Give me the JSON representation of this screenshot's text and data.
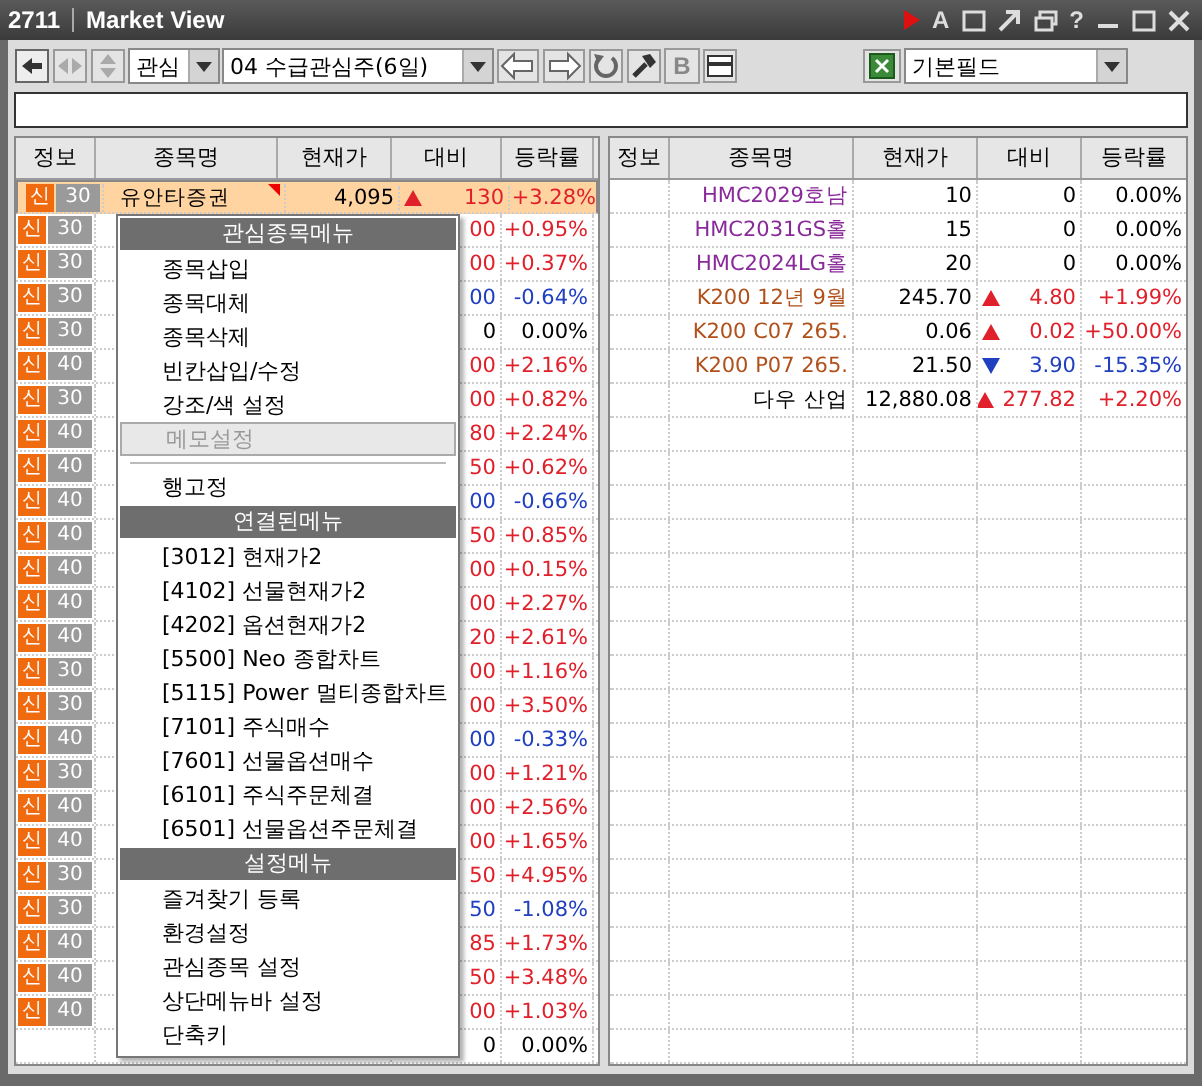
{
  "window": {
    "code": "2711",
    "title": "Market View",
    "help_glyph": "?",
    "font_glyph": "A"
  },
  "toolbar": {
    "group_select": "관심",
    "list_select": "04 수급관심주(6일)",
    "bold_glyph": "B",
    "field_select": "기본필드"
  },
  "left_table": {
    "columns": [
      "정보",
      "종목명",
      "현재가",
      "대비",
      "등락률"
    ],
    "rows": [
      {
        "badge": "신",
        "tag": "30",
        "name": "유안타증권",
        "price": "4,095",
        "arrow_up": true,
        "change": "130",
        "rate": "+3.28%",
        "color": "#e0202a",
        "selected": true,
        "flagged": true
      },
      {
        "badge": "신",
        "tag": "30",
        "change": "00",
        "rate": "+0.95%",
        "color": "#e0202a",
        "selected": false
      },
      {
        "badge": "신",
        "tag": "30",
        "change": "00",
        "rate": "+0.37%",
        "color": "#e0202a",
        "selected": false
      },
      {
        "badge": "신",
        "tag": "30",
        "change": "00",
        "rate": "-0.64%",
        "color": "#2040c0",
        "selected": false
      },
      {
        "badge": "신",
        "tag": "30",
        "change": "0",
        "rate": "0.00%",
        "color": "#000000",
        "selected": false
      },
      {
        "badge": "신",
        "tag": "40",
        "change": "00",
        "rate": "+2.16%",
        "color": "#e0202a",
        "selected": false
      },
      {
        "badge": "신",
        "tag": "30",
        "change": "00",
        "rate": "+0.82%",
        "color": "#e0202a",
        "selected": false
      },
      {
        "badge": "신",
        "tag": "40",
        "change": "80",
        "rate": "+2.24%",
        "color": "#e0202a",
        "selected": false
      },
      {
        "badge": "신",
        "tag": "40",
        "change": "50",
        "rate": "+0.62%",
        "color": "#e0202a",
        "selected": false
      },
      {
        "badge": "신",
        "tag": "40",
        "change": "00",
        "rate": "-0.66%",
        "color": "#2040c0",
        "selected": false
      },
      {
        "badge": "신",
        "tag": "40",
        "change": "50",
        "rate": "+0.85%",
        "color": "#e0202a",
        "selected": false
      },
      {
        "badge": "신",
        "tag": "40",
        "change": "00",
        "rate": "+0.15%",
        "color": "#e0202a",
        "selected": false
      },
      {
        "badge": "신",
        "tag": "40",
        "change": "00",
        "rate": "+2.27%",
        "color": "#e0202a",
        "selected": false
      },
      {
        "badge": "신",
        "tag": "40",
        "change": "20",
        "rate": "+2.61%",
        "color": "#e0202a",
        "selected": false
      },
      {
        "badge": "신",
        "tag": "30",
        "change": "00",
        "rate": "+1.16%",
        "color": "#e0202a",
        "selected": false
      },
      {
        "badge": "신",
        "tag": "30",
        "change": "00",
        "rate": "+3.50%",
        "color": "#e0202a",
        "selected": false
      },
      {
        "badge": "신",
        "tag": "40",
        "change": "00",
        "rate": "-0.33%",
        "color": "#2040c0",
        "selected": false
      },
      {
        "badge": "신",
        "tag": "30",
        "change": "00",
        "rate": "+1.21%",
        "color": "#e0202a",
        "selected": false
      },
      {
        "badge": "신",
        "tag": "40",
        "change": "00",
        "rate": "+2.56%",
        "color": "#e0202a",
        "selected": false
      },
      {
        "badge": "신",
        "tag": "40",
        "change": "00",
        "rate": "+1.65%",
        "color": "#e0202a",
        "selected": false
      },
      {
        "badge": "신",
        "tag": "30",
        "change": "50",
        "rate": "+4.95%",
        "color": "#e0202a",
        "selected": false
      },
      {
        "badge": "신",
        "tag": "30",
        "change": "50",
        "rate": "-1.08%",
        "color": "#2040c0",
        "selected": false
      },
      {
        "badge": "신",
        "tag": "40",
        "change": "85",
        "rate": "+1.73%",
        "color": "#e0202a",
        "selected": false
      },
      {
        "badge": "신",
        "tag": "40",
        "change": "50",
        "rate": "+3.48%",
        "color": "#e0202a",
        "selected": false
      },
      {
        "badge": "신",
        "tag": "40",
        "change": "00",
        "rate": "+1.03%",
        "color": "#e0202a",
        "selected": false
      },
      {
        "change": "0",
        "rate": "0.00%",
        "color": "#000000",
        "selected": false
      }
    ]
  },
  "context_menu": {
    "items": [
      {
        "kind": "header",
        "label": "관심종목메뉴"
      },
      {
        "kind": "item",
        "label": "종목삽입",
        "disabled": false
      },
      {
        "kind": "item",
        "label": "종목대체",
        "disabled": false
      },
      {
        "kind": "item",
        "label": "종목삭제",
        "disabled": false
      },
      {
        "kind": "item",
        "label": "빈칸삽입/수정",
        "disabled": false
      },
      {
        "kind": "item",
        "label": "강조/색 설정",
        "disabled": false
      },
      {
        "kind": "item",
        "label": "메모설정",
        "disabled": true,
        "selected": true
      },
      {
        "kind": "separator"
      },
      {
        "kind": "item",
        "label": "행고정",
        "disabled": false
      },
      {
        "kind": "header",
        "label": "연결된메뉴"
      },
      {
        "kind": "item",
        "label": "[3012] 현재가2",
        "disabled": false
      },
      {
        "kind": "item",
        "label": "[4102] 선물현재가2",
        "disabled": false
      },
      {
        "kind": "item",
        "label": "[4202] 옵션현재가2",
        "disabled": false
      },
      {
        "kind": "item",
        "label": "[5500] Neo 종합차트",
        "disabled": false
      },
      {
        "kind": "item",
        "label": "[5115] Power 멀티종합차트",
        "disabled": false
      },
      {
        "kind": "item",
        "label": "[7101] 주식매수",
        "disabled": false
      },
      {
        "kind": "item",
        "label": "[7601] 선물옵션매수",
        "disabled": false
      },
      {
        "kind": "item",
        "label": "[6101] 주식주문체결",
        "disabled": false
      },
      {
        "kind": "item",
        "label": "[6501] 선물옵션주문체결",
        "disabled": false
      },
      {
        "kind": "header",
        "label": "설정메뉴"
      },
      {
        "kind": "item",
        "label": "즐겨찾기 등록",
        "disabled": false
      },
      {
        "kind": "item",
        "label": "환경설정",
        "disabled": false
      },
      {
        "kind": "item",
        "label": "관심종목 설정",
        "disabled": false
      },
      {
        "kind": "item",
        "label": "상단메뉴바 설정",
        "disabled": false
      },
      {
        "kind": "item",
        "label": "단축키",
        "disabled": false
      }
    ]
  },
  "right_table": {
    "columns": [
      "정보",
      "종목명",
      "현재가",
      "대비",
      "등락률"
    ],
    "rows": [
      {
        "name": {
          "text": "HMC2029호남",
          "color": "#8a2a9a"
        },
        "price": "10",
        "change": "0",
        "rate": "0.00%",
        "color": "#000000"
      },
      {
        "name": {
          "text": "HMC2031GS홀",
          "color": "#8a2a9a"
        },
        "price": "15",
        "change": "0",
        "rate": "0.00%",
        "color": "#000000"
      },
      {
        "name": {
          "text": "HMC2024LG홀",
          "color": "#8a2a9a"
        },
        "price": "20",
        "change": "0",
        "rate": "0.00%",
        "color": "#000000"
      },
      {
        "name": {
          "text": "K200 12년  9월",
          "color": "#b0501a"
        },
        "price": "245.70",
        "arrow_up": true,
        "change": "4.80",
        "rate": "+1.99%",
        "color": "#e0202a"
      },
      {
        "name": {
          "text": "K200 C07 265.",
          "color": "#b0501a"
        },
        "price": "0.06",
        "arrow_up": true,
        "change": "0.02",
        "rate": "+50.00%",
        "color": "#e0202a"
      },
      {
        "name": {
          "text": "K200 P07 265.",
          "color": "#b0501a"
        },
        "price": "21.50",
        "arrow_up": false,
        "change": "3.90",
        "rate": "-15.35%",
        "color": "#2040c0"
      },
      {
        "name": {
          "text": "다우 산업",
          "color": "#000000"
        },
        "price": "12,880.08",
        "arrow_up": true,
        "change": "277.82",
        "rate": "+2.20%",
        "color": "#e0202a"
      }
    ]
  }
}
